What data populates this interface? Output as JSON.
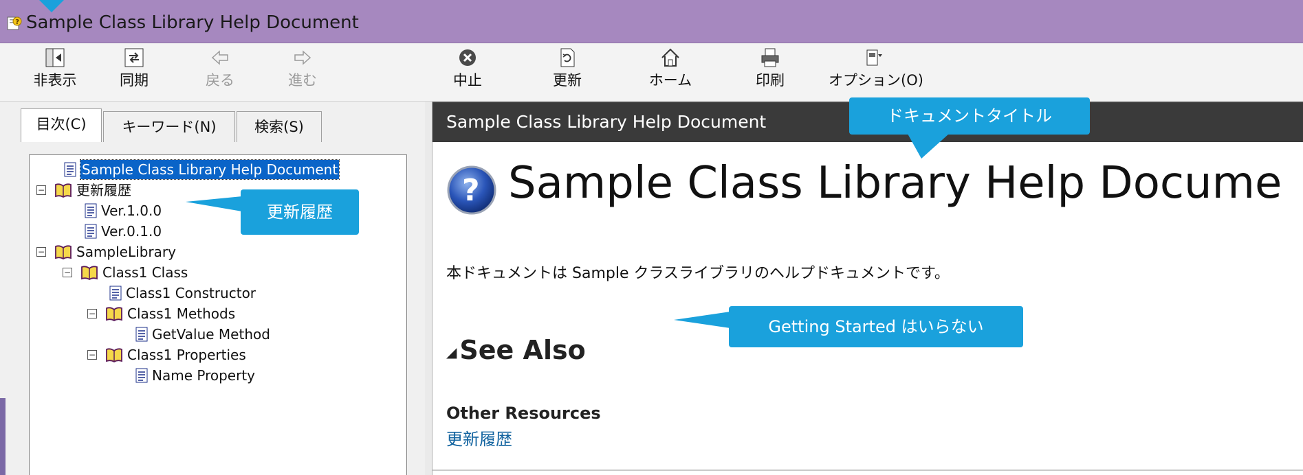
{
  "window": {
    "title": "Sample Class Library Help Document"
  },
  "toolbar": {
    "hide": "非表示",
    "sync": "同期",
    "back": "戻る",
    "forward": "進む",
    "stop": "中止",
    "refresh": "更新",
    "home": "ホーム",
    "print": "印刷",
    "options": "オプション(O)"
  },
  "tabs": {
    "contents": "目次(C)",
    "keyword": "キーワード(N)",
    "search": "検索(S)"
  },
  "tree": {
    "root": "Sample Class Library Help Document",
    "history": "更新履歴",
    "ver100": "Ver.1.0.0",
    "ver010": "Ver.0.1.0",
    "sample_library": "SampleLibrary",
    "class1": "Class1 Class",
    "constructor": "Class1 Constructor",
    "methods": "Class1 Methods",
    "getvalue": "GetValue Method",
    "properties": "Class1 Properties",
    "name_property": "Name Property",
    "expander_glyph": "−"
  },
  "content": {
    "header_title": "Sample Class Library Help Document",
    "page_title": "Sample Class Library Help Docume",
    "intro": "本ドキュメントは Sample クラスライブラリのヘルプドキュメントです。",
    "see_also": "See Also",
    "see_also_marker": "◢",
    "other_resources": "Other Resources",
    "history_link": "更新履歴"
  },
  "callouts": {
    "doc_title": "ドキュメントタイトル",
    "history": "更新履歴",
    "getting_started": "Getting Started はいらない"
  },
  "colors": {
    "titlebar": "#a688bf",
    "callout": "#1aa1dc",
    "header_dark": "#3a3a3a",
    "selection": "#0a64c8",
    "link": "#1364a0"
  }
}
